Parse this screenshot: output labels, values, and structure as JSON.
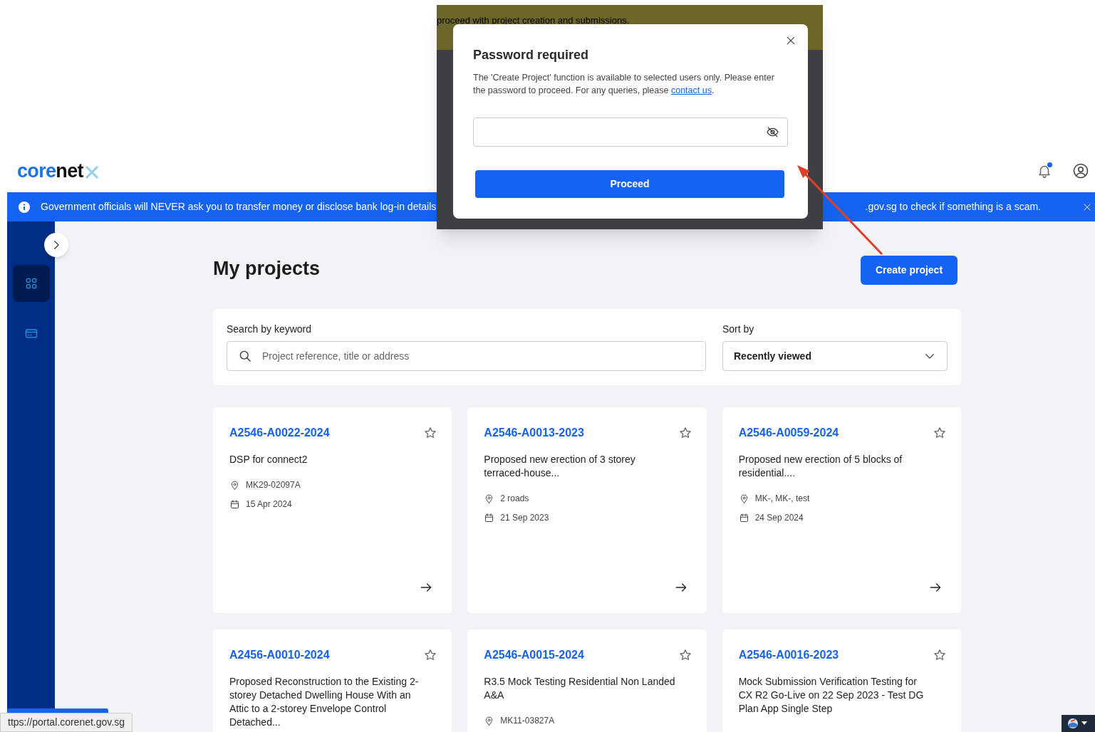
{
  "modal": {
    "background_text": "proceed with project creation and submissions.",
    "title": "Password required",
    "message": "The 'Create Project' function is available to selected users only. Please enter the password to proceed. For any queries, please ",
    "link": "contact us",
    "message_end": ".",
    "button": "Proceed"
  },
  "header": {
    "logo": {
      "accent": "core",
      "rest": "net"
    },
    "notification_unread": true
  },
  "banner": {
    "text_left": "Government officials will NEVER ask you to transfer money or disclose bank log-in details",
    "text_right": ".gov.sg to check if something is a scam."
  },
  "sidebar": {
    "items": [
      {
        "kind": "grid",
        "selected": true
      },
      {
        "kind": "card",
        "selected": false
      }
    ]
  },
  "page": {
    "title": "My projects",
    "create_button": "Create project"
  },
  "search": {
    "label": "Search by keyword",
    "placeholder": "Project reference, title or address",
    "sort_label": "Sort by",
    "sort_value": "Recently viewed"
  },
  "projects": [
    {
      "reference": "A2546-A0022-2024",
      "title": "DSP for connect2",
      "location": "MK29-02097A",
      "date": "15 Apr 2024",
      "starred": false
    },
    {
      "reference": "A2546-A0013-2023",
      "title": "Proposed new erection of 3 storey terraced-house...",
      "location": "2 roads",
      "date": "21 Sep 2023",
      "starred": false
    },
    {
      "reference": "A2546-A0059-2024",
      "title": "Proposed new erection of 5 blocks of residential....",
      "location": "MK-, MK-, test",
      "date": "24 Sep 2024",
      "starred": false
    },
    {
      "reference": "A2456-A0010-2024",
      "title": "Proposed Reconstruction to the Existing 2-storey Detached Dwelling House With an Attic to a 2-storey Envelope Control Detached...",
      "starred": false
    },
    {
      "reference": "A2546-A0015-2024",
      "title": "R3.5 Mock Testing Residential Non Landed A&A",
      "location": "MK11-03827A",
      "starred": false
    },
    {
      "reference": "A2546-A0016-2023",
      "title": "Mock Submission Verification Testing for CX R2 Go-Live on 22 Sep 2023 - Test DG Plan App Single Step",
      "starred": false
    }
  ],
  "status_url": "ttps://portal.corenet.gov.sg"
}
